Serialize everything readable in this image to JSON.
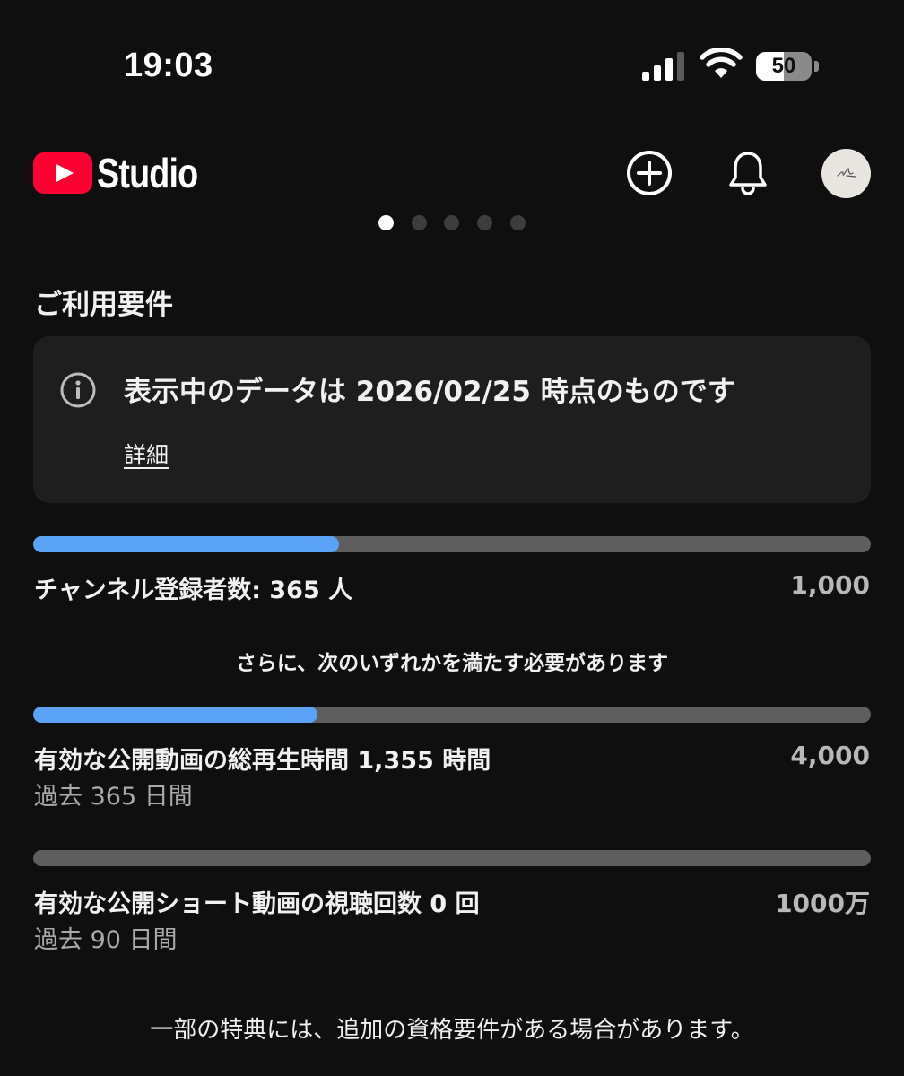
{
  "status_bar": {
    "time": "19:03",
    "battery_level": "50",
    "icons": [
      "signal-icon",
      "wifi-icon",
      "battery-icon"
    ]
  },
  "header": {
    "app_name": "Studio",
    "icons": [
      "youtube-logo-icon",
      "create-plus-icon",
      "bell-icon",
      "avatar"
    ]
  },
  "pager": {
    "count": 5,
    "active_index": 0
  },
  "eligibility": {
    "title": "ご利用要件",
    "info": {
      "text": "表示中のデータは 2026/02/25 時点のものです",
      "details_link": "詳細"
    },
    "subscribers": {
      "label": "チャンネル登録者数: 365 人",
      "target": "1,000",
      "progress": 0.365
    },
    "also_required": "さらに、次のいずれかを満たす必要があります",
    "watch_hours": {
      "label": "有効な公開動画の総再生時間 1,355 時間",
      "sub": "過去 365 日間",
      "target": "4,000",
      "progress": 0.339
    },
    "shorts_views": {
      "label": "有効な公開ショート動画の視聴回数 0 回",
      "sub": "過去 90 日間",
      "target": "1000万",
      "progress": 0
    },
    "footer": "一部の特典には、追加の資格要件がある場合があります。"
  },
  "colors": {
    "background": "#0f0f0f",
    "card": "#1e1e1e",
    "progress_fill": "#5aa2f6",
    "progress_track": "#5e5e5e",
    "youtube_red": "#ff0033"
  }
}
